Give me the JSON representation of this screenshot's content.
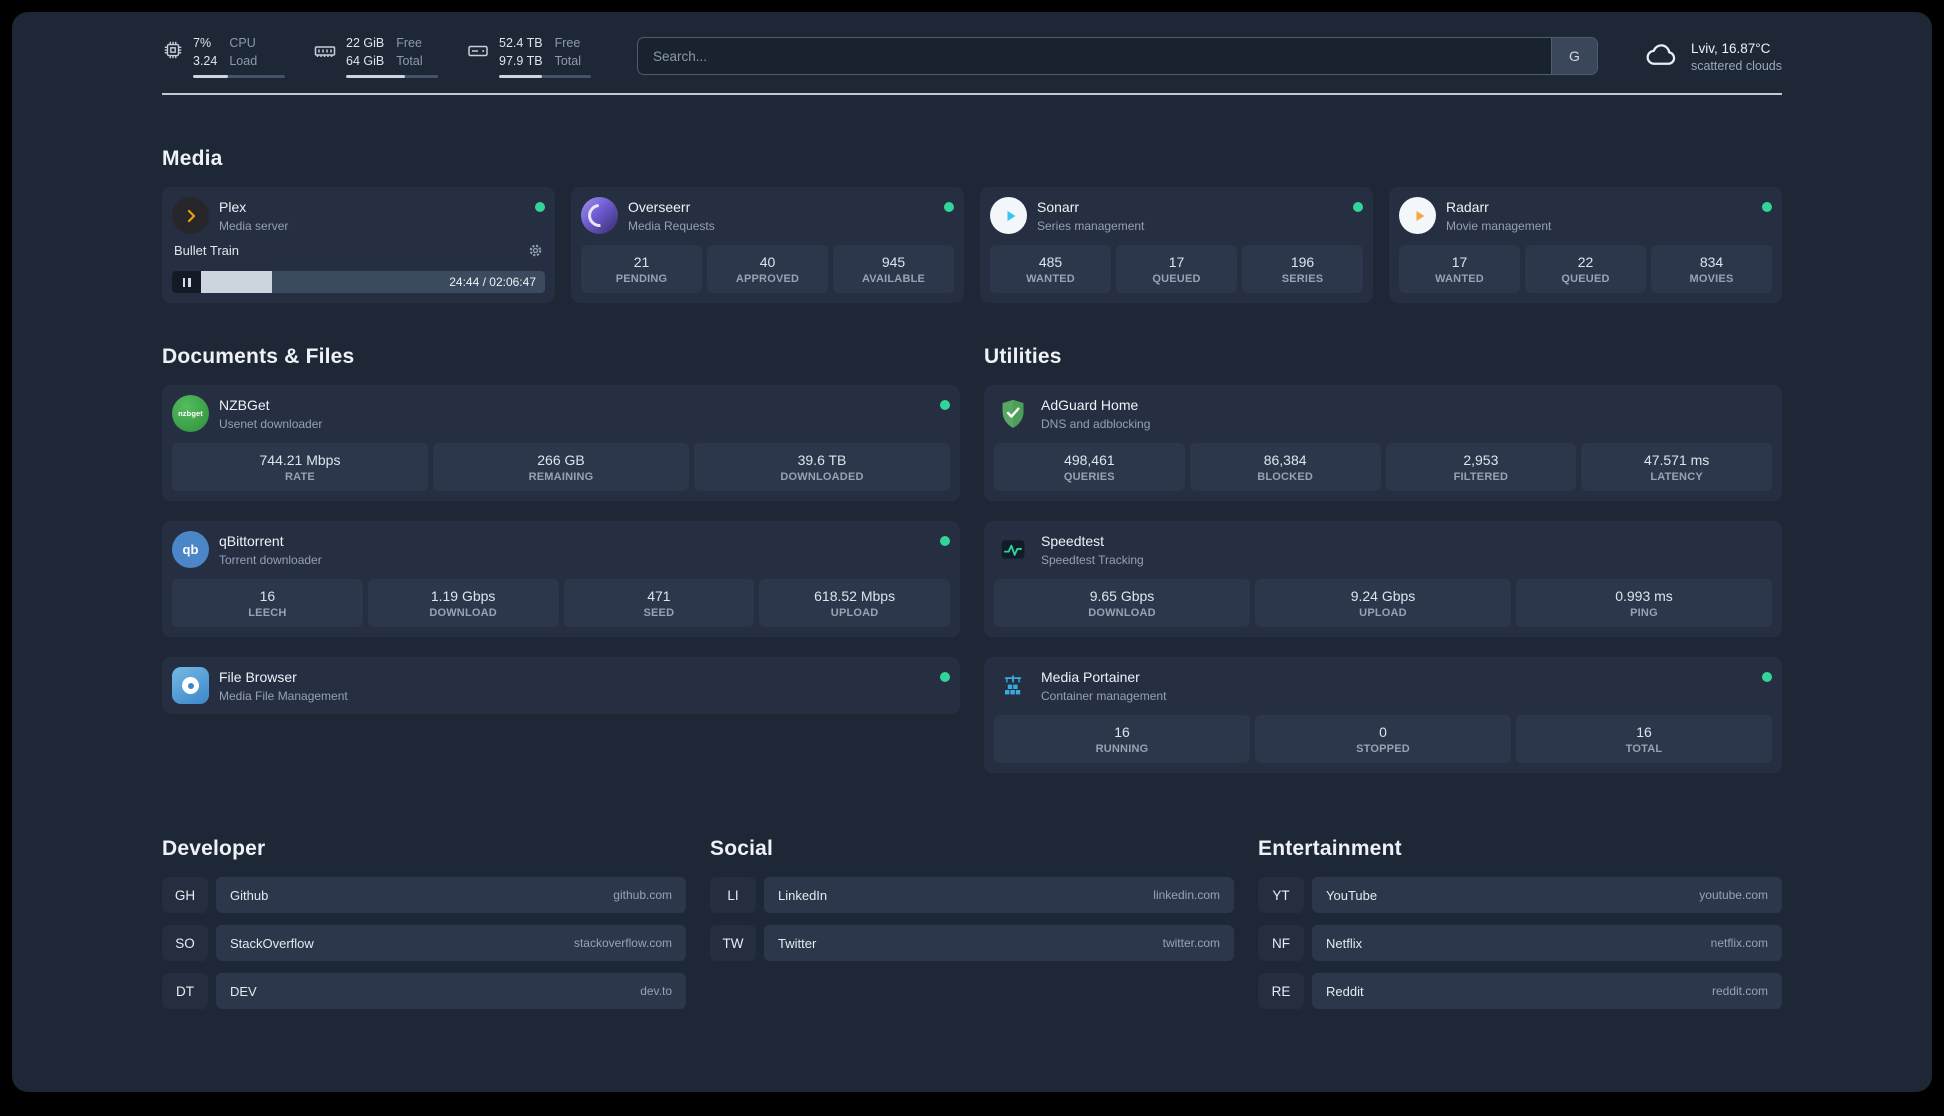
{
  "topbar": {
    "cpu": {
      "percent": "7%",
      "load": "3.24",
      "label_top": "CPU",
      "label_bottom": "Load",
      "bar_percent": 38
    },
    "memory": {
      "free": "22 GiB",
      "total": "64 GiB",
      "label_top": "Free",
      "label_bottom": "Total",
      "bar_percent": 64
    },
    "disk": {
      "free": "52.4 TB",
      "total": "97.9 TB",
      "label_top": "Free",
      "label_bottom": "Total",
      "bar_percent": 47
    },
    "search": {
      "placeholder": "Search...",
      "button_label": "G"
    },
    "weather": {
      "location": "Lviv, 16.87°C",
      "condition": "scattered clouds"
    }
  },
  "media": {
    "title": "Media",
    "plex": {
      "name": "Plex",
      "subtitle": "Media server",
      "now_playing": "Bullet Train",
      "time": "24:44 / 02:06:47",
      "progress_percent": 19
    },
    "overseerr": {
      "name": "Overseerr",
      "subtitle": "Media Requests",
      "stats": [
        {
          "value": "21",
          "label": "PENDING"
        },
        {
          "value": "40",
          "label": "APPROVED"
        },
        {
          "value": "945",
          "label": "AVAILABLE"
        }
      ]
    },
    "sonarr": {
      "name": "Sonarr",
      "subtitle": "Series management",
      "stats": [
        {
          "value": "485",
          "label": "WANTED"
        },
        {
          "value": "17",
          "label": "QUEUED"
        },
        {
          "value": "196",
          "label": "SERIES"
        }
      ]
    },
    "radarr": {
      "name": "Radarr",
      "subtitle": "Movie management",
      "stats": [
        {
          "value": "17",
          "label": "WANTED"
        },
        {
          "value": "22",
          "label": "QUEUED"
        },
        {
          "value": "834",
          "label": "MOVIES"
        }
      ]
    }
  },
  "documents": {
    "title": "Documents & Files",
    "nzbget": {
      "name": "NZBGet",
      "subtitle": "Usenet downloader",
      "icon_text": "nzbget",
      "stats": [
        {
          "value": "744.21 Mbps",
          "label": "RATE"
        },
        {
          "value": "266 GB",
          "label": "REMAINING"
        },
        {
          "value": "39.6 TB",
          "label": "DOWNLOADED"
        }
      ]
    },
    "qbittorrent": {
      "name": "qBittorrent",
      "subtitle": "Torrent downloader",
      "icon_text": "qb",
      "stats": [
        {
          "value": "16",
          "label": "LEECH"
        },
        {
          "value": "1.19 Gbps",
          "label": "DOWNLOAD"
        },
        {
          "value": "471",
          "label": "SEED"
        },
        {
          "value": "618.52 Mbps",
          "label": "UPLOAD"
        }
      ]
    },
    "filebrowser": {
      "name": "File Browser",
      "subtitle": "Media File Management"
    }
  },
  "utilities": {
    "title": "Utilities",
    "adguard": {
      "name": "AdGuard Home",
      "subtitle": "DNS and adblocking",
      "stats": [
        {
          "value": "498,461",
          "label": "QUERIES"
        },
        {
          "value": "86,384",
          "label": "BLOCKED"
        },
        {
          "value": "2,953",
          "label": "FILTERED"
        },
        {
          "value": "47.571 ms",
          "label": "LATENCY"
        }
      ]
    },
    "speedtest": {
      "name": "Speedtest",
      "subtitle": "Speedtest Tracking",
      "stats": [
        {
          "value": "9.65 Gbps",
          "label": "DOWNLOAD"
        },
        {
          "value": "9.24 Gbps",
          "label": "UPLOAD"
        },
        {
          "value": "0.993 ms",
          "label": "PING"
        }
      ]
    },
    "portainer": {
      "name": "Media Portainer",
      "subtitle": "Container management",
      "stats": [
        {
          "value": "16",
          "label": "RUNNING"
        },
        {
          "value": "0",
          "label": "STOPPED"
        },
        {
          "value": "16",
          "label": "TOTAL"
        }
      ]
    }
  },
  "bookmarks": {
    "developer": {
      "title": "Developer",
      "items": [
        {
          "abbr": "GH",
          "name": "Github",
          "url": "github.com"
        },
        {
          "abbr": "SO",
          "name": "StackOverflow",
          "url": "stackoverflow.com"
        },
        {
          "abbr": "DT",
          "name": "DEV",
          "url": "dev.to"
        }
      ]
    },
    "social": {
      "title": "Social",
      "items": [
        {
          "abbr": "LI",
          "name": "LinkedIn",
          "url": "linkedin.com"
        },
        {
          "abbr": "TW",
          "name": "Twitter",
          "url": "twitter.com"
        }
      ]
    },
    "entertainment": {
      "title": "Entertainment",
      "items": [
        {
          "abbr": "YT",
          "name": "YouTube",
          "url": "youtube.com"
        },
        {
          "abbr": "NF",
          "name": "Netflix",
          "url": "netflix.com"
        },
        {
          "abbr": "RE",
          "name": "Reddit",
          "url": "reddit.com"
        }
      ]
    }
  },
  "colors": {
    "status_online": "#34d399",
    "plex": "#e5a00d",
    "overseerr": "#6d5bd0",
    "sonarr": "#35c5f4",
    "radarr": "#f5a73b",
    "nzbget": "#3db54a",
    "qbittorrent": "#4a86c8",
    "filebrowser": "#4ea8de",
    "adguard": "#57a863",
    "speedtest": "#2dd4a0",
    "portainer": "#3aa9dc"
  }
}
